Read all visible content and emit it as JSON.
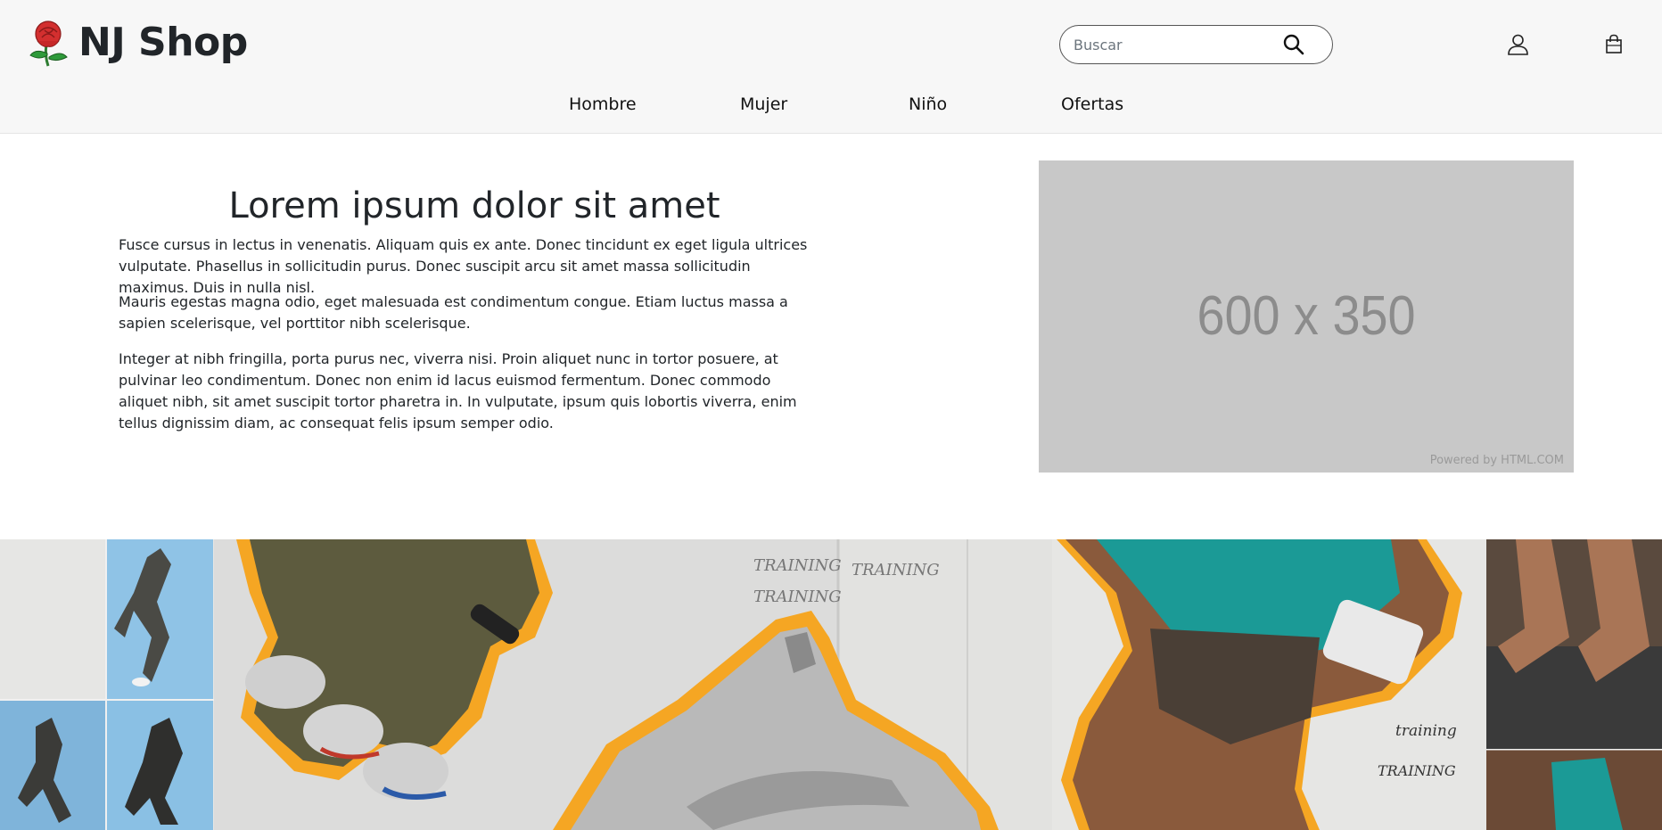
{
  "header": {
    "brand_name": "NJ Shop",
    "logo_icon": "rose-icon",
    "search": {
      "placeholder": "Buscar",
      "value": "",
      "icon": "search-icon"
    },
    "account_icon": "user-icon",
    "cart_icon": "shopping-bag-icon"
  },
  "nav": {
    "items": [
      {
        "label": "Hombre"
      },
      {
        "label": "Mujer"
      },
      {
        "label": "Niño"
      },
      {
        "label": "Ofertas"
      }
    ]
  },
  "main": {
    "heading": "Lorem ipsum dolor sit amet",
    "paragraphs": [
      "Fusce cursus in lectus in venenatis. Aliquam quis ex ante. Donec tincidunt ex eget ligula ultrices vulputate. Phasellus in sollicitudin purus. Donec suscipit arcu sit amet massa sollicitudin maximus. Duis in nulla nisl.",
      "Mauris egestas magna odio, eget malesuada est condimentum congue. Etiam luctus massa a sapien scelerisque, vel porttitor nibh scelerisque.",
      "Integer at nibh fringilla, porta purus nec, viverra nisi. Proin aliquet nunc in tortor posuere, at pulvinar leo condimentum. Donec non enim id lacus euismod fermentum. Donec commodo aliquet nibh, sit amet suscipit tortor pharetra in. In vulputate, ipsum quis lobortis viverra, enim tellus dignissim diam, ac consequat felis ipsum semper odio."
    ],
    "placeholder_image": {
      "label": "600 x 350",
      "credit": "Powered by HTML.COM"
    }
  },
  "banner": {
    "handwriting": [
      "TRAINING",
      "TRAINING",
      "TRAINING",
      "training",
      "TRAINING"
    ]
  },
  "colors": {
    "header_bg": "#f7f7f7",
    "text": "#212529",
    "placeholder_bg": "#c8c8c8",
    "accent_orange": "#f5a623",
    "teal": "#1b9a96"
  }
}
